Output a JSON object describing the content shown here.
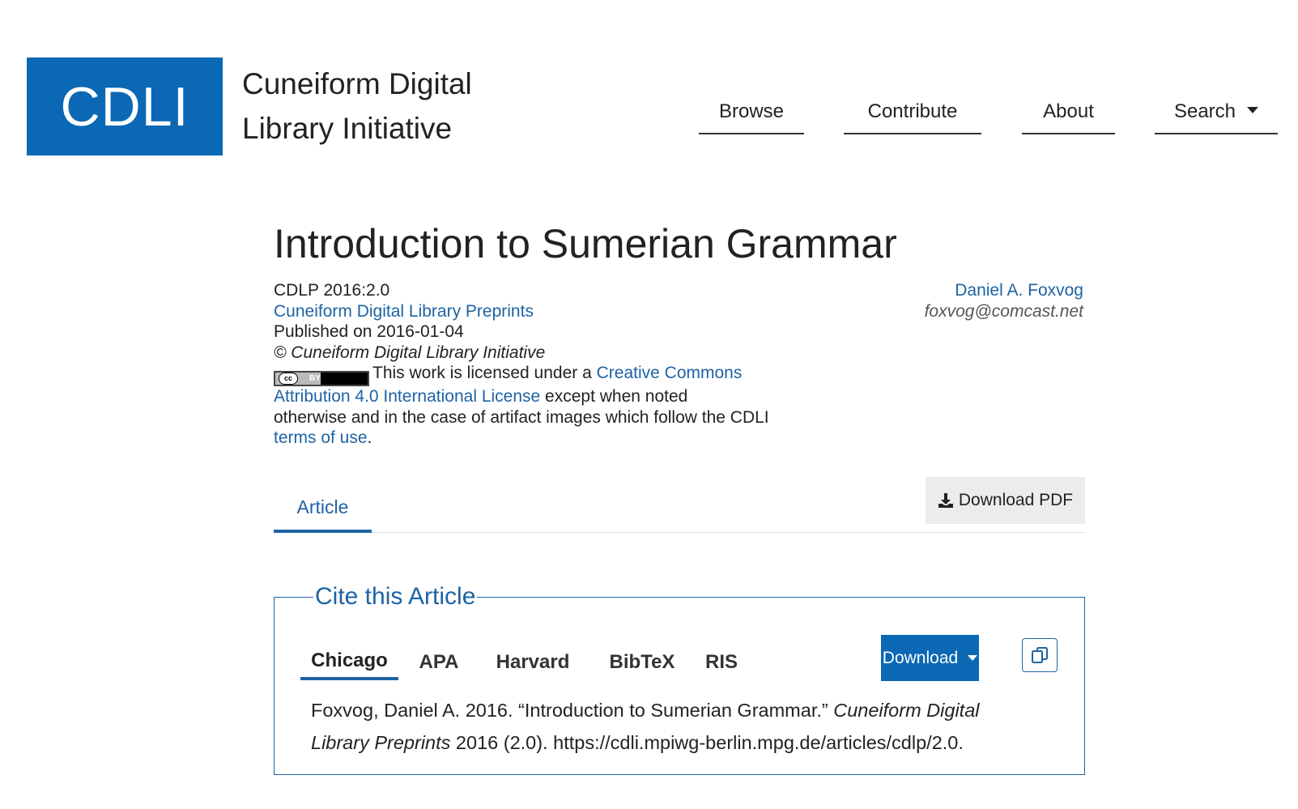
{
  "header": {
    "logo_text": "CDLI",
    "site_name_line1": "Cuneiform Digital",
    "site_name_line2": "Library Initiative",
    "nav": {
      "browse": "Browse",
      "contribute": "Contribute",
      "about": "About",
      "search": "Search"
    }
  },
  "article": {
    "title": "Introduction to Sumerian Grammar",
    "id": "CDLP 2016:2.0",
    "series_link": "Cuneiform Digital Library Preprints",
    "published": "Published on 2016-01-04",
    "copyright": "© Cuneiform Digital Library Initiative",
    "license": {
      "badge_cc": "cc",
      "badge_by": "BY",
      "prefix": "This work is licensed under a ",
      "link_part1": "Creative Commons",
      "link_part2": "Attribution 4.0 International License",
      "after_link": " except when noted",
      "line3": "otherwise and in the case of artifact images which follow the CDLI",
      "terms_link": "terms of use",
      "period": "."
    },
    "author_name": "Daniel A. Foxvog",
    "author_email": "foxvog@comcast.net"
  },
  "tabs": {
    "article": "Article",
    "download_pdf": "Download PDF"
  },
  "cite": {
    "legend": "Cite this Article",
    "styles": {
      "chicago": "Chicago",
      "apa": "APA",
      "harvard": "Harvard",
      "bibtex": "BibTeX",
      "ris": "RIS"
    },
    "download_label": "Download",
    "citation": {
      "part1": "Foxvog, Daniel A. 2016. “Introduction to Sumerian Grammar.” ",
      "journal_part1": "Cuneiform Digital",
      "journal_part2": "Library Preprints",
      "part2": " 2016 (2.0). https://cdli.mpiwg-berlin.mpg.de/articles/cdlp/2.0."
    }
  },
  "colors": {
    "brand_blue": "#0b68b4",
    "link_blue": "#1e63a4"
  }
}
